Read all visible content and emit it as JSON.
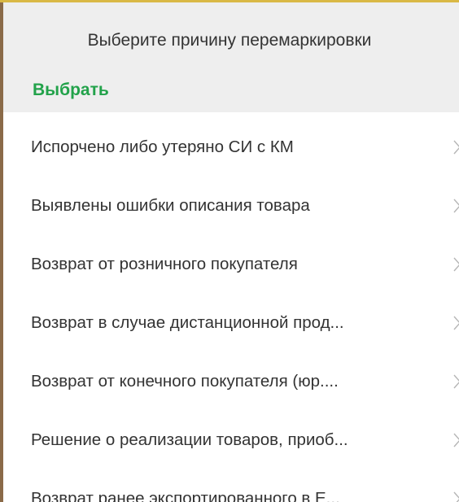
{
  "header": {
    "title": "Выберите причину перемаркировки",
    "choose_label": "Выбрать"
  },
  "reasons": [
    "Испорчено либо утеряно СИ с КМ",
    "Выявлены ошибки описания товара",
    "Возврат от розничного покупателя",
    "Возврат в случае дистанционной прод...",
    "Возврат от конечного покупателя (юр....",
    "Решение о реализации товаров, приоб...",
    "Возврат ранее экспортированного в Е..."
  ],
  "icons": {
    "row_chevron": "chevron-right-icon"
  },
  "colors": {
    "accent_green": "#22a24a",
    "header_bg": "#eeeeee",
    "text": "#333333",
    "chevron": "#b5b5b5",
    "left_border": "#8a6a48",
    "top_border": "#d9b845"
  }
}
